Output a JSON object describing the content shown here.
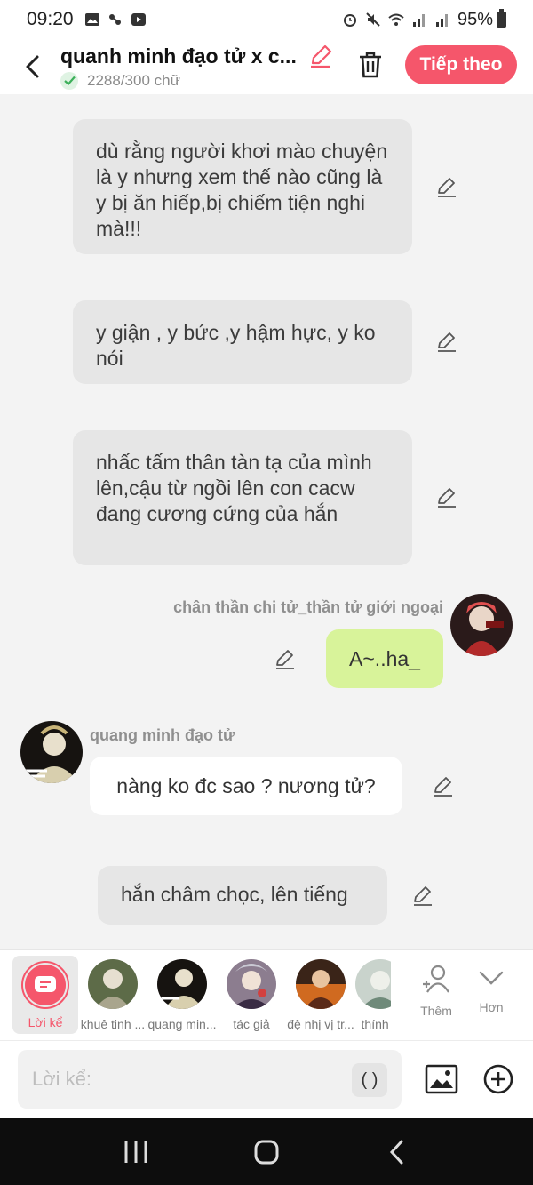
{
  "status_bar": {
    "time": "09:20",
    "battery": "95%"
  },
  "header": {
    "title": "quanh minh đạo tử x c...",
    "word_count": "2288/300 chữ",
    "next_button": "Tiếp theo",
    "accent_color": "#f5566b"
  },
  "messages": {
    "narration_1": "dù rằng người khơi mào chuyện là y  nhưng xem thế nào cũng là y bị ăn hiếp,bị chiếm tiện nghi mà!!!",
    "narration_2": "y giận , y bức ,y hậm hực, y ko nói",
    "narration_3": "nhấc tấm thân tàn tạ của mình lên,cậu từ ngồi lên con cacw đang cương cứng của hắn",
    "right_name": "chân thần chi tử_thần tử giới ngoại",
    "right_text": "A~..ha_",
    "left_name": "quang minh đạo tử",
    "left_text": "nàng ko đc sao ? nương tử?",
    "narration_4": "hắn châm chọc, lên tiếng"
  },
  "char_bar": {
    "narrator_label": "Lời kể",
    "characters": [
      {
        "label": "khuê tinh ..."
      },
      {
        "label": "quang min..."
      },
      {
        "label": "tác giả"
      },
      {
        "label": "đệ nhị vị tr..."
      },
      {
        "label": "thính t"
      }
    ],
    "add_label": "Thêm",
    "more_label": "Hơn"
  },
  "input": {
    "placeholder": "Lời kể:",
    "paren": "( )"
  }
}
